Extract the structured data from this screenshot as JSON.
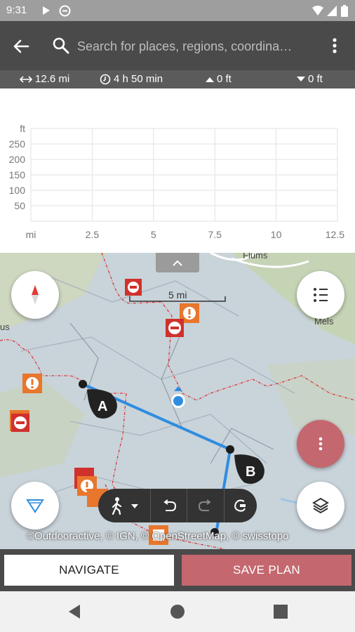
{
  "status_bar": {
    "time": "9:31"
  },
  "search": {
    "placeholder": "Search for places, regions, coordina…"
  },
  "stats": {
    "distance": "12.6 mi",
    "duration": "4 h 50 min",
    "ascent": "0 ft",
    "descent": "0 ft"
  },
  "chart_data": {
    "type": "line",
    "x_unit": "mi",
    "y_unit": "ft",
    "x_ticks": [
      "2.5",
      "5",
      "7.5",
      "10",
      "12.5"
    ],
    "y_ticks": [
      "250",
      "200",
      "150",
      "100",
      "50"
    ],
    "xlim": [
      0,
      12.5
    ],
    "ylim": [
      0,
      300
    ],
    "grid": true,
    "series": []
  },
  "map": {
    "scale_label": "5 mi",
    "places": [
      "Flums",
      "Mels",
      "us"
    ],
    "markers": [
      "A",
      "B"
    ],
    "attribution": "©Outdooractive, © IGN, © OpenStreetMap, © swisstopo"
  },
  "actions": {
    "navigate": "NAVIGATE",
    "save_plan": "SAVE PLAN"
  },
  "colors": {
    "accent": "#c4676f",
    "route": "#2e8de0",
    "toolbar": "#4a4a4a"
  }
}
